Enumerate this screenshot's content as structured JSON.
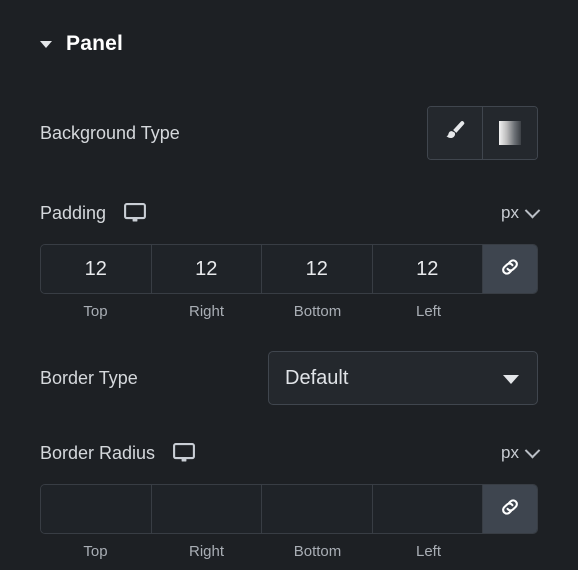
{
  "panel": {
    "title": "Panel",
    "collapse_icon": "caret-down-icon",
    "expanded": true
  },
  "controls": {
    "background_type": {
      "label": "Background Type",
      "options": [
        {
          "name": "classic",
          "icon": "paint-brush-icon"
        },
        {
          "name": "gradient",
          "icon": "gradient-swatch-icon"
        }
      ]
    },
    "padding": {
      "label": "Padding",
      "device_icon": "desktop-monitor-icon",
      "unit": "px",
      "unit_chevron": "chevron-down-icon",
      "link_icon": "link-chain-icon",
      "linked": true,
      "values": {
        "top": "12",
        "right": "12",
        "bottom": "12",
        "left": "12"
      },
      "side_labels": [
        "Top",
        "Right",
        "Bottom",
        "Left"
      ]
    },
    "border_type": {
      "label": "Border Type",
      "value": "Default",
      "arrow_icon": "triangle-down-icon"
    },
    "border_radius": {
      "label": "Border Radius",
      "device_icon": "desktop-monitor-icon",
      "unit": "px",
      "unit_chevron": "chevron-down-icon",
      "link_icon": "link-chain-icon",
      "linked": true,
      "values": {
        "top": "",
        "right": "",
        "bottom": "",
        "left": ""
      },
      "side_labels": [
        "Top",
        "Right",
        "Bottom",
        "Left"
      ]
    }
  },
  "colors": {
    "background": "#1d2024",
    "field_background": "#1f2328",
    "field_border": "#383d44",
    "link_active": "#3e454f",
    "label_text": "#d5d8dc",
    "muted_text": "#a9aeb5",
    "title_text": "#ffffff"
  }
}
